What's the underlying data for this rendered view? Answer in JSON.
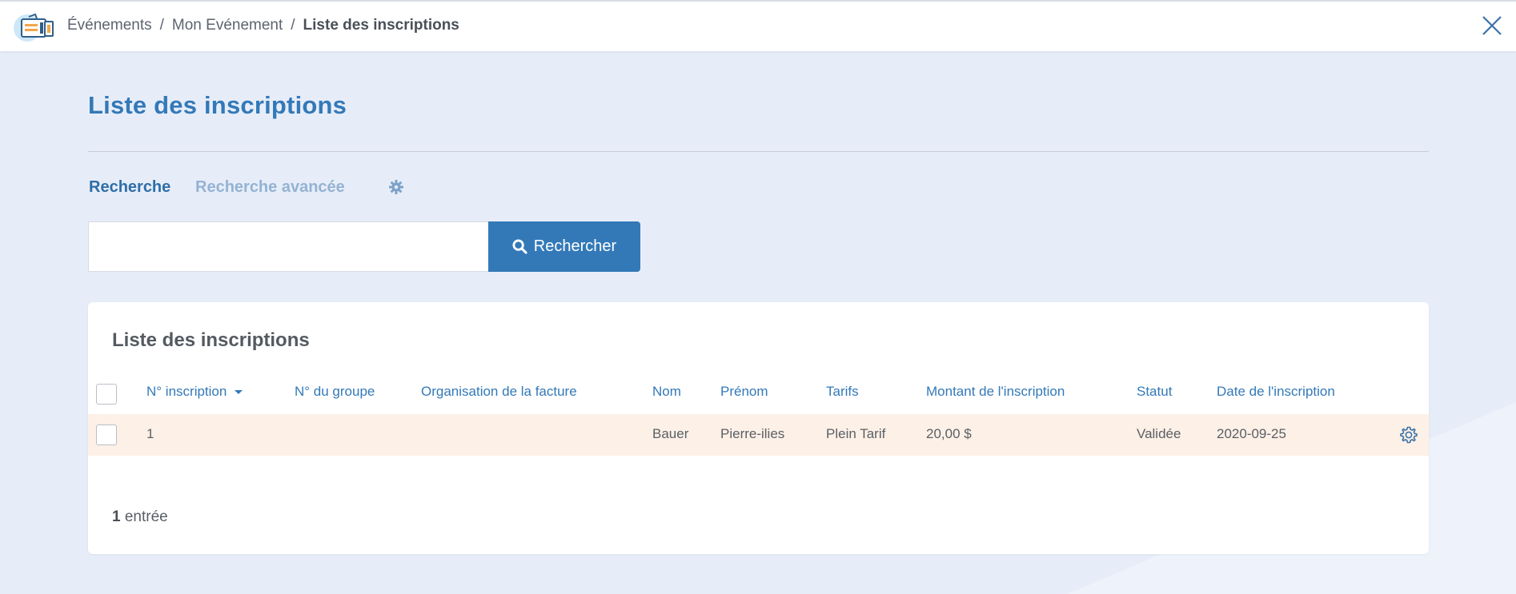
{
  "header": {
    "breadcrumb": [
      "Événements",
      "Mon Evénement",
      "Liste des inscriptions"
    ],
    "separator": "/"
  },
  "page": {
    "title": "Liste des inscriptions"
  },
  "search": {
    "tabs": [
      "Recherche",
      "Recherche avancée"
    ],
    "input_value": "",
    "button_label": "Rechercher"
  },
  "table": {
    "title": "Liste des inscriptions",
    "columns": [
      "N° inscription",
      "N° du groupe",
      "Organisation de la facture",
      "Nom",
      "Prénom",
      "Tarifs",
      "Montant de l'inscription",
      "Statut",
      "Date de l'inscription"
    ],
    "sort_column": "N° inscription",
    "sort_direction": "desc",
    "rows": [
      {
        "numero": "1",
        "groupe": "",
        "organisation": "",
        "nom": "Bauer",
        "prenom": "Pierre-ilies",
        "tarif": "Plein Tarif",
        "montant": "20,00 $",
        "statut": "Validée",
        "date": "2020-09-25"
      }
    ],
    "count": "1",
    "count_label": "entrée"
  },
  "colors": {
    "accent": "#3379b8",
    "row_highlight": "#fdf0e6",
    "background": "#e7edf8"
  },
  "icons": [
    "ticket-logo-icon",
    "close-icon",
    "gear-icon",
    "search-icon",
    "sort-caret-icon",
    "row-settings-icon"
  ]
}
